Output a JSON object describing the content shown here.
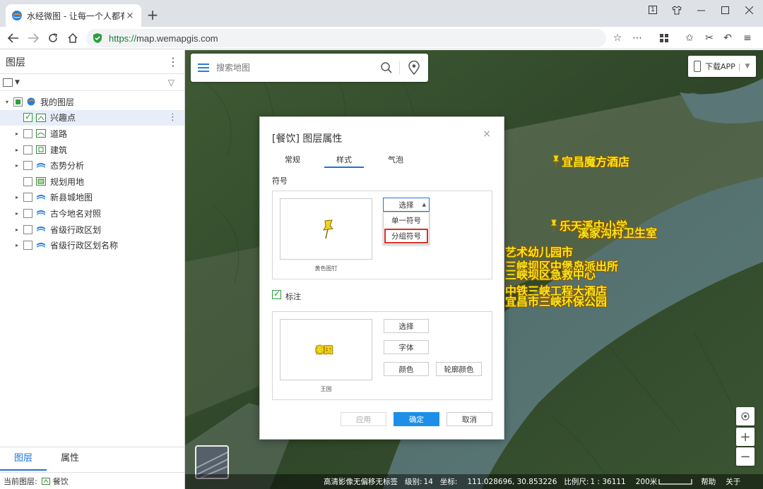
{
  "browser": {
    "tab_title": "水经微图 - 让每一个人都有自",
    "tab_close": "×",
    "new_tab": "+",
    "url_scheme": "https://",
    "url_host": "map.wemapgis.com",
    "window_badge": "1"
  },
  "left_panel": {
    "title": "图层",
    "more": "⋮",
    "filter": "▽",
    "layers": [
      {
        "label": "我的图层",
        "expander": "▾",
        "state": "partial",
        "icon": "globe-icon"
      },
      {
        "label": "兴趣点",
        "expander": "",
        "state": "checked",
        "icon": "poi-layer-icon",
        "selected": true,
        "more": "⋮"
      },
      {
        "label": "道路",
        "expander": "▸",
        "state": "unchecked",
        "icon": "road-layer-icon"
      },
      {
        "label": "建筑",
        "expander": "▸",
        "state": "unchecked",
        "icon": "building-layer-icon"
      },
      {
        "label": "态势分析",
        "expander": "▸",
        "state": "unchecked",
        "icon": "web-layer-icon"
      },
      {
        "label": "规划用地",
        "expander": "",
        "state": "unchecked",
        "icon": "landuse-layer-icon"
      },
      {
        "label": "新县城地图",
        "expander": "▸",
        "state": "unchecked",
        "icon": "web-layer-icon"
      },
      {
        "label": "古今地名对照",
        "expander": "▸",
        "state": "unchecked",
        "icon": "web-layer-icon"
      },
      {
        "label": "省级行政区划",
        "expander": "▸",
        "state": "unchecked",
        "icon": "web-layer-icon"
      },
      {
        "label": "省级行政区划名称",
        "expander": "▸",
        "state": "unchecked",
        "icon": "web-layer-icon"
      }
    ],
    "bottom_tabs": [
      "图层",
      "属性"
    ],
    "current_layer_label": "当前图层:",
    "current_layer_value": "餐饮"
  },
  "map": {
    "search_placeholder": "搜索地图",
    "download_app": "下载APP",
    "pois": [
      {
        "label": "宜昌魔方酒店"
      },
      {
        "label": "乐天溪中小学"
      },
      {
        "label": "溪家沟村卫生室"
      },
      {
        "label": "艺术幼儿园市"
      },
      {
        "label": "三峡坝区中堡岛派出所"
      },
      {
        "label": "三峡坝区急救中心"
      },
      {
        "label": "中铁三峡工程大酒店"
      },
      {
        "label": "宜昌市三峡环保公园"
      }
    ],
    "zoom_in": "+",
    "zoom_out": "−",
    "status": {
      "imagery": "高清影像无偏移无标签",
      "level_label": "级别:",
      "level": "14",
      "coord_label": "坐标:",
      "coords": "111.028696, 30.853226",
      "scale_label": "比例尺:",
      "scale": "1 : 36111",
      "distance": "200米",
      "help": "帮助",
      "about": "关于"
    }
  },
  "dialog": {
    "title": "[餐饮] 图层属性",
    "close": "×",
    "tabs": [
      "常规",
      "样式",
      "气泡"
    ],
    "active_tab": "样式",
    "symbol_section": "符号",
    "symbol_caption": "黄色图钉",
    "select_label": "选择",
    "dropdown_options": [
      "单一符号",
      "分组符号"
    ],
    "highlighted_option": "分组符号",
    "annotation_section": "标注",
    "annotation_preview_text": "秦国",
    "annotation_caption": "王国",
    "annot_select": "选择",
    "font_button": "字体",
    "color_button": "颜色",
    "outline_color_button": "轮廓颜色",
    "apply_button": "应用",
    "ok_button": "确定",
    "cancel_button": "取消"
  },
  "colors": {
    "accent": "#1e73d8",
    "primary_button": "#1e8fe8",
    "poi_label": "#f7e51b",
    "highlight_box": "#d93025",
    "check_green": "#2e9e3f"
  }
}
